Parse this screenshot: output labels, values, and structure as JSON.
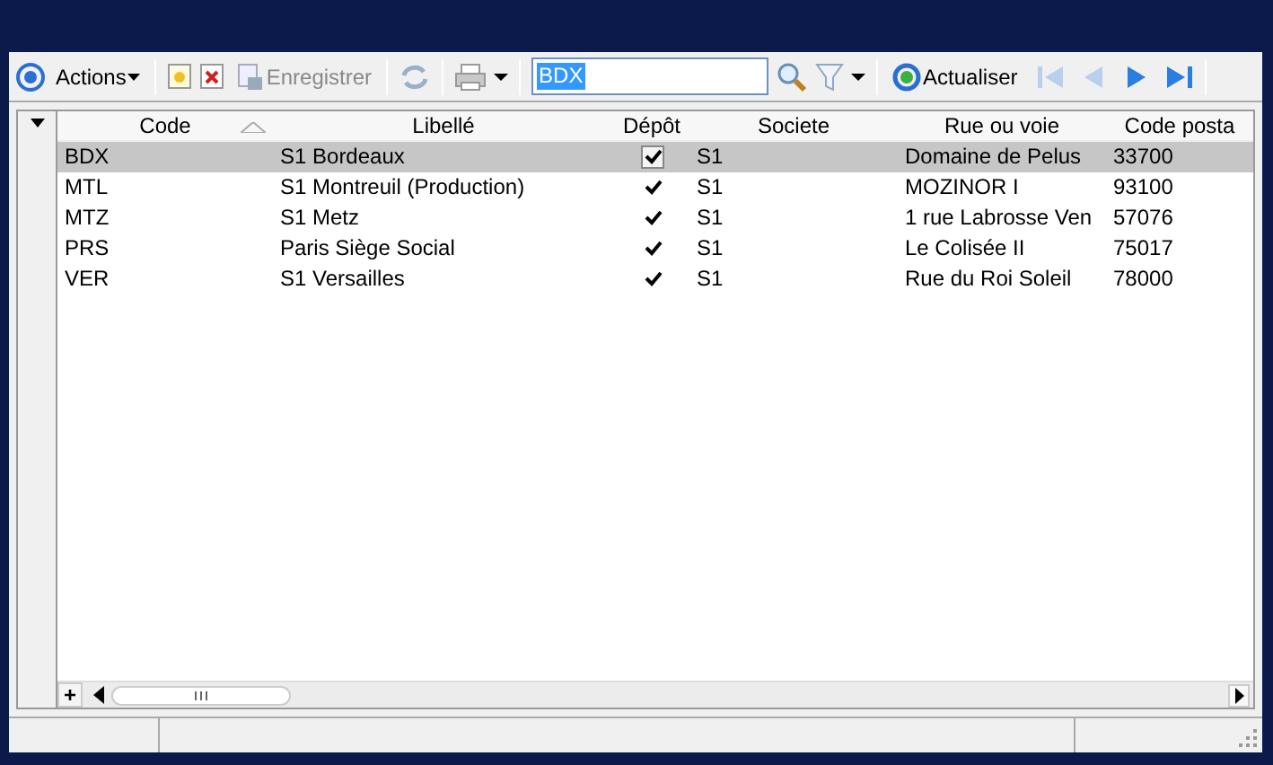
{
  "toolbar": {
    "actions": "Actions",
    "save": {
      "label": "Enregistrer",
      "disabled": true
    },
    "refresh_disabled": true,
    "search": {
      "value": "BDX"
    },
    "reload": "Actualiser",
    "nav": [
      {
        "kind": "first",
        "disabled": true
      },
      {
        "kind": "prev",
        "disabled": true
      },
      {
        "kind": "next",
        "disabled": false
      },
      {
        "kind": "last",
        "disabled": false
      }
    ]
  },
  "table": {
    "columns": [
      {
        "label": "Code",
        "sorted": true
      },
      {
        "label": "Libellé",
        "sorted": false
      },
      {
        "label": "Dépôt",
        "sorted": false
      },
      {
        "label": "Societe",
        "sorted": false
      },
      {
        "label": "Rue ou voie",
        "sorted": false
      },
      {
        "label": "Code posta",
        "sorted": false
      }
    ],
    "rows": [
      {
        "code": "BDX",
        "libelle": "S1 Bordeaux",
        "depot": true,
        "societe": "S1",
        "rue": "Domaine de Pelus",
        "code_postal": "33700",
        "selected": true
      },
      {
        "code": "MTL",
        "libelle": "S1 Montreuil (Production)",
        "depot": true,
        "societe": "S1",
        "rue": "MOZINOR I",
        "code_postal": "93100",
        "selected": false
      },
      {
        "code": "MTZ",
        "libelle": "S1 Metz",
        "depot": true,
        "societe": "S1",
        "rue": "1 rue Labrosse Ven",
        "code_postal": "57076",
        "selected": false
      },
      {
        "code": "PRS",
        "libelle": "Paris Siège Social",
        "depot": true,
        "societe": "S1",
        "rue": "Le Colisée II",
        "code_postal": "75017",
        "selected": false
      },
      {
        "code": "VER",
        "libelle": "S1 Versailles",
        "depot": true,
        "societe": "S1",
        "rue": "Rue du Roi Soleil",
        "code_postal": "78000",
        "selected": false
      }
    ],
    "add_button": "+"
  }
}
